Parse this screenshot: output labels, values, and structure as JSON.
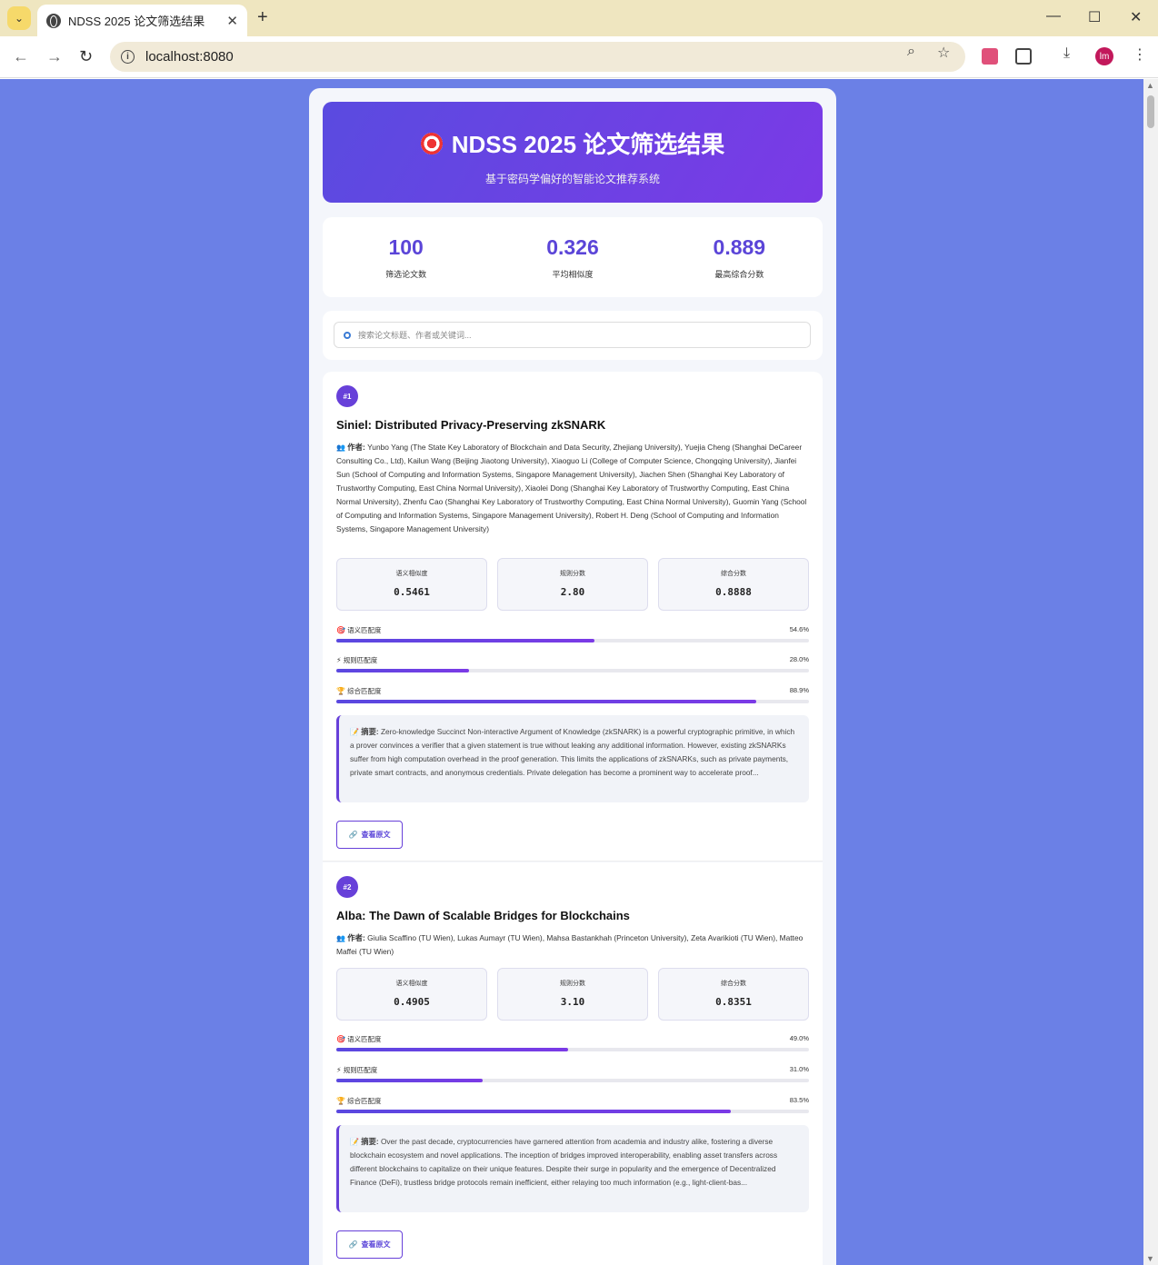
{
  "browser": {
    "tab_title": "NDSS 2025 论文筛选结果",
    "url": "localhost:8080",
    "profile_initials": "lm"
  },
  "header": {
    "title": "NDSS 2025 论文筛选结果",
    "subtitle": "基于密码学偏好的智能论文推荐系统"
  },
  "stats": [
    {
      "value": "100",
      "label": "筛选论文数"
    },
    {
      "value": "0.326",
      "label": "平均相似度"
    },
    {
      "value": "0.889",
      "label": "最高综合分数"
    }
  ],
  "search": {
    "placeholder": "搜索论文标题、作者或关键词..."
  },
  "labels": {
    "authors": "作者:",
    "abstract": "摘要:",
    "view_original": "查看原文",
    "semantic_similarity": "语义相似度",
    "rule_score": "规则分数",
    "combined_score": "综合分数",
    "semantic_match": "语义匹配度",
    "rule_match": "规则匹配度",
    "combined_match": "综合匹配度"
  },
  "papers": [
    {
      "rank": "#1",
      "title": "Siniel: Distributed Privacy-Preserving zkSNARK",
      "authors": "Yunbo Yang (The State Key Laboratory of Blockchain and Data Security, Zhejiang University), Yuejia Cheng (Shanghai DeCareer Consulting Co., Ltd), Kailun Wang (Beijing Jiaotong University), Xiaoguo Li (College of Computer Science, Chongqing University), Jianfei Sun (School of Computing and Information Systems, Singapore Management University), Jiachen Shen (Shanghai Key Laboratory of Trustworthy Computing, East China Normal University), Xiaolei Dong (Shanghai Key Laboratory of Trustworthy Computing, East China Normal University), Zhenfu Cao (Shanghai Key Laboratory of Trustworthy Computing, East China Normal University), Guomin Yang (School of Computing and Information Systems, Singapore Management University), Robert H. Deng (School of Computing and Information Systems, Singapore Management University)",
      "semantic": "0.5461",
      "rule": "2.80",
      "combined": "0.8888",
      "semantic_pct": "54.6%",
      "rule_pct": "28.0%",
      "combined_pct": "88.9%",
      "semantic_frac": 0.546,
      "rule_frac": 0.28,
      "combined_frac": 0.889,
      "abstract": "Zero-knowledge Succinct Non-interactive Argument of Knowledge (zkSNARK) is a powerful cryptographic primitive, in which a prover convinces a verifier that a given statement is true without leaking any additional information. However, existing zkSNARKs suffer from high computation overhead in the proof generation. This limits the applications of zkSNARKs, such as private payments, private smart contracts, and anonymous credentials. Private delegation has become a prominent way to accelerate proof..."
    },
    {
      "rank": "#2",
      "title": "Alba: The Dawn of Scalable Bridges for Blockchains",
      "authors": "Giulia Scaffino (TU Wien), Lukas Aumayr (TU Wien), Mahsa Bastankhah (Princeton University), Zeta Avarikioti (TU Wien), Matteo Maffei (TU Wien)",
      "semantic": "0.4905",
      "rule": "3.10",
      "combined": "0.8351",
      "semantic_pct": "49.0%",
      "rule_pct": "31.0%",
      "combined_pct": "83.5%",
      "semantic_frac": 0.49,
      "rule_frac": 0.31,
      "combined_frac": 0.835,
      "abstract": "Over the past decade, cryptocurrencies have garnered attention from academia and industry alike, fostering a diverse blockchain ecosystem and novel applications. The inception of bridges improved interoperability, enabling asset transfers across different blockchains to capitalize on their unique features. Despite their surge in popularity and the emergence of Decentralized Finance (DeFi), trustless bridge protocols remain inefficient, either relaying too much information (e.g., light-client-bas..."
    }
  ]
}
